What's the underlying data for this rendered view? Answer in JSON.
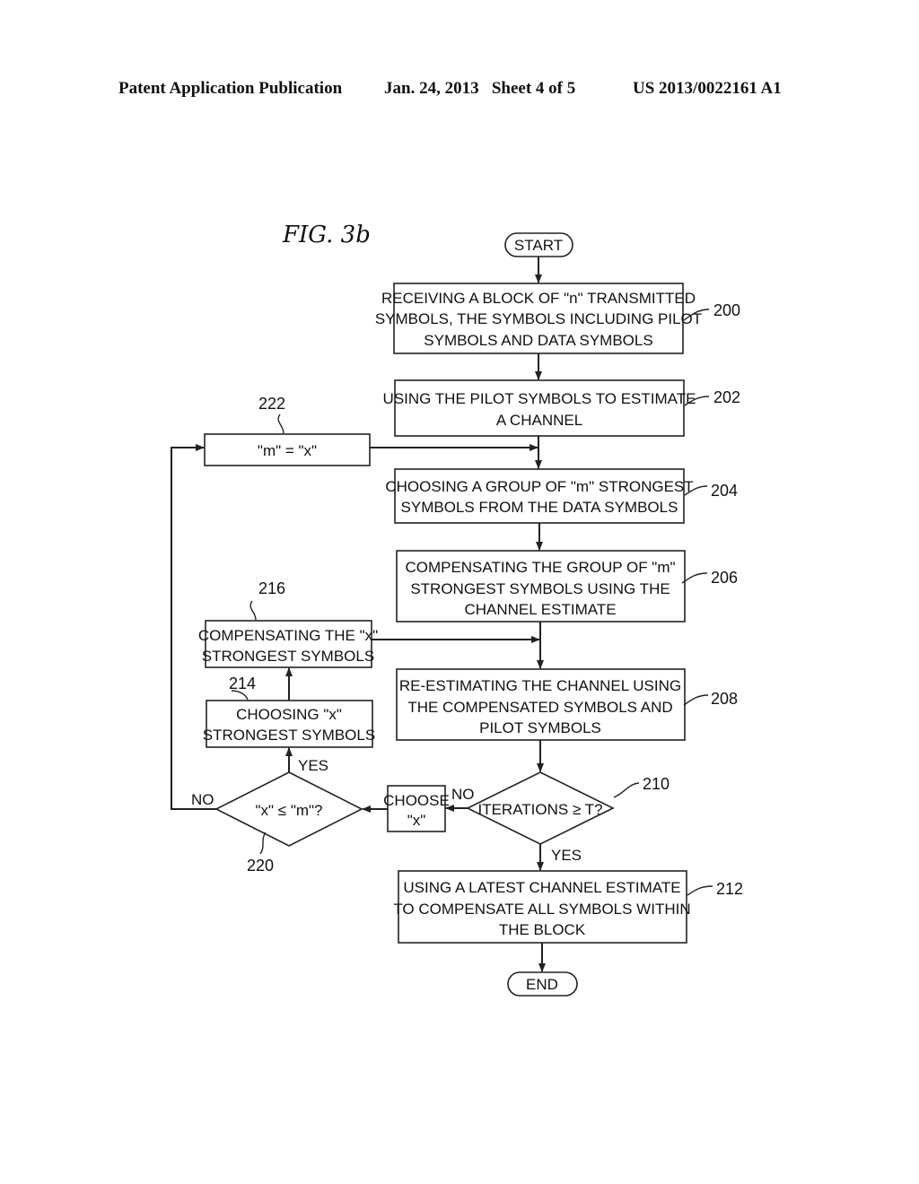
{
  "header": {
    "publication": "Patent Application Publication",
    "date_sheet": "Jan. 24, 2013   Sheet 4 of 5",
    "number": "US 2013/0022161 A1"
  },
  "figure": {
    "title": "FIG.  3b",
    "start": "START",
    "end": "END",
    "steps": {
      "s200": {
        "ref": "200",
        "lines": [
          "RECEIVING A BLOCK OF \"n\" TRANSMITTED",
          "SYMBOLS, THE SYMBOLS INCLUDING PILOT",
          "SYMBOLS AND DATA SYMBOLS"
        ]
      },
      "s202": {
        "ref": "202",
        "lines": [
          "USING THE PILOT SYMBOLS TO ESTIMATE",
          "A CHANNEL"
        ]
      },
      "s204": {
        "ref": "204",
        "lines": [
          "CHOOSING A GROUP OF \"m\" STRONGEST",
          "SYMBOLS FROM THE DATA SYMBOLS"
        ]
      },
      "s206": {
        "ref": "206",
        "lines": [
          "COMPENSATING THE GROUP OF \"m\"",
          "STRONGEST SYMBOLS USING THE",
          "CHANNEL ESTIMATE"
        ]
      },
      "s208": {
        "ref": "208",
        "lines": [
          "RE-ESTIMATING THE CHANNEL USING",
          "THE COMPENSATED SYMBOLS AND",
          "PILOT SYMBOLS"
        ]
      },
      "s210": {
        "ref": "210",
        "lines": [
          "ITERATIONS ≥ T?"
        ]
      },
      "s212": {
        "ref": "212",
        "lines": [
          "USING A LATEST CHANNEL ESTIMATE",
          "TO COMPENSATE ALL SYMBOLS WITHIN",
          "THE BLOCK"
        ]
      },
      "s214": {
        "ref": "214",
        "lines": [
          "CHOOSING \"x\"",
          "STRONGEST SYMBOLS"
        ]
      },
      "s216": {
        "ref": "216",
        "lines": [
          "COMPENSATING THE \"x\"",
          "STRONGEST SYMBOLS"
        ]
      },
      "s220": {
        "ref": "220",
        "lines": [
          "\"x\" ≤ \"m\"?"
        ]
      },
      "s222": {
        "ref": "222",
        "lines": [
          "\"m\" = \"x\""
        ]
      },
      "choose": {
        "lines": [
          "CHOOSE",
          "\"x\""
        ]
      }
    },
    "edge_labels": {
      "no_210": "NO",
      "yes_210": "YES",
      "no_220": "NO",
      "yes_220": "YES"
    }
  }
}
